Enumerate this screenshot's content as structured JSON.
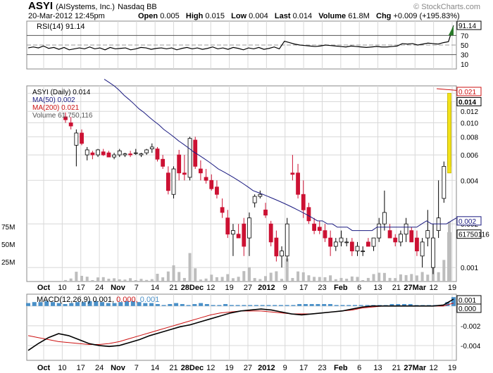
{
  "header": {
    "symbol": "ASYI",
    "company": "(AISystems, Inc.)",
    "exchange": "Nasdaq BB",
    "date": "20-Mar-2012 12:45pm",
    "watermark": "© StockCharts.com",
    "quote": {
      "open_label": "Open",
      "open": "0.005",
      "high_label": "High",
      "high": "0.015",
      "low_label": "Low",
      "low": "0.004",
      "last_label": "Last",
      "last": "0.014",
      "volume_label": "Volume",
      "volume": "61.8M",
      "chg_label": "Chg",
      "chg": "+0.009 (+195.83%)"
    }
  },
  "colors": {
    "up": "#ffffff",
    "down": "#cc1133",
    "ma50": "#1a1a80",
    "ma200": "#cc1111",
    "macd": "#000000",
    "signal": "#cc1111",
    "hist": "#4a90c8",
    "volume": "#bdbdbd",
    "grid": "#d8d8d8",
    "rsi_fill": "#2a7a2a"
  },
  "xaxis": {
    "labels": [
      "Oct",
      "10",
      "17",
      "24",
      "Nov",
      "7",
      "14",
      "21",
      "28Dec",
      "12",
      "19",
      "27",
      "2012",
      "9",
      "17",
      "23",
      "Feb",
      "6",
      "13",
      "21",
      "27Mar",
      "12",
      "19"
    ],
    "bold": [
      "Oct",
      "Nov",
      "28Dec",
      "2012",
      "Feb",
      "27Mar"
    ]
  },
  "chart_data": [
    {
      "type": "line",
      "title": "RSI(14) 91.14",
      "indicator": "RSI(14)",
      "last": 91.14,
      "last_label": "91.14",
      "ylim": [
        0,
        100
      ],
      "yticks": [
        "90",
        "70",
        "50",
        "30",
        "10"
      ],
      "ref_lines": [
        70,
        50,
        30
      ],
      "series": [
        {
          "name": "RSI(14)",
          "values": [
            44,
            46,
            44,
            48,
            43,
            45,
            41,
            45,
            40,
            42,
            44,
            42,
            46,
            42,
            44,
            40,
            45,
            42,
            43,
            44,
            40,
            42,
            45,
            44,
            41,
            43,
            44,
            42,
            44,
            40,
            43,
            45,
            42,
            44,
            41,
            43,
            46,
            42,
            44,
            41,
            45,
            43,
            40,
            44,
            42,
            45,
            41,
            43,
            46,
            42,
            58,
            55,
            52,
            50,
            49,
            48,
            47,
            48,
            50,
            49,
            48,
            47,
            46,
            48,
            47,
            46,
            45,
            46,
            47,
            46,
            46,
            47,
            48,
            53,
            52,
            53,
            50,
            52,
            54,
            53,
            52,
            55,
            57,
            91
          ]
        }
      ]
    },
    {
      "type": "candlestick",
      "title": "ASYI (Daily) 0.014",
      "legend": [
        "ASYI (Daily) 0.014",
        "MA(50) 0.002",
        "MA(200) 0.021",
        "Volume 61,750,116"
      ],
      "scale": "log",
      "ylim": [
        0.0008,
        0.018
      ],
      "yticks": [
        "0.016",
        "0.014",
        "0.012",
        "0.010",
        "0.008",
        "0.006",
        "0.004",
        "0.002",
        "0.001"
      ],
      "price_labels": {
        "last": "0.014",
        "ma50": "0.002",
        "ma200": "0.021",
        "volume": "61750116"
      },
      "volume_ticks": [
        "75M",
        "50M",
        "25M"
      ],
      "candles": [
        [
          0.011,
          0.0118,
          0.01,
          0.0105
        ],
        [
          0.01,
          0.011,
          0.009,
          0.0095
        ],
        [
          0.007,
          0.009,
          0.005,
          0.0085
        ],
        [
          0.0085,
          0.009,
          0.007,
          0.0072
        ],
        [
          0.006,
          0.0068,
          0.0055,
          0.0065
        ],
        [
          0.0062,
          0.0064,
          0.0056,
          0.006
        ],
        [
          0.006,
          0.0066,
          0.0058,
          0.0065
        ],
        [
          0.0063,
          0.0066,
          0.0059,
          0.006
        ],
        [
          0.0062,
          0.0064,
          0.0058,
          0.0058
        ],
        [
          0.0058,
          0.0062,
          0.0056,
          0.006
        ],
        [
          0.006,
          0.0066,
          0.0058,
          0.0064
        ],
        [
          0.006,
          0.0062,
          0.0058,
          0.0061
        ],
        [
          0.0061,
          0.0064,
          0.0058,
          0.006
        ],
        [
          0.0062,
          0.0066,
          0.006,
          0.0062
        ],
        [
          0.006,
          0.0062,
          0.0058,
          0.0061
        ],
        [
          0.0062,
          0.0066,
          0.006,
          0.0065
        ],
        [
          0.0066,
          0.0072,
          0.0062,
          0.0068
        ],
        [
          0.0066,
          0.0068,
          0.0054,
          0.0056
        ],
        [
          0.0056,
          0.006,
          0.0048,
          0.005
        ],
        [
          0.0045,
          0.005,
          0.0032,
          0.0034
        ],
        [
          0.0032,
          0.005,
          0.003,
          0.0048
        ],
        [
          0.006,
          0.0065,
          0.004,
          0.0045
        ],
        [
          0.0045,
          0.006,
          0.004,
          0.0044
        ],
        [
          0.0042,
          0.008,
          0.004,
          0.0078
        ],
        [
          0.0076,
          0.008,
          0.0048,
          0.005
        ],
        [
          0.0048,
          0.0055,
          0.004,
          0.0045
        ],
        [
          0.0042,
          0.0048,
          0.0038,
          0.004
        ],
        [
          0.004,
          0.0044,
          0.0034,
          0.0035
        ],
        [
          0.0036,
          0.004,
          0.003,
          0.0032
        ],
        [
          0.0026,
          0.003,
          0.0022,
          0.0024
        ],
        [
          0.0022,
          0.0025,
          0.0016,
          0.0017
        ],
        [
          0.0017,
          0.002,
          0.0012,
          0.0018
        ],
        [
          0.0017,
          0.002,
          0.0016,
          0.0016
        ],
        [
          0.002,
          0.0022,
          0.0012,
          0.0014
        ],
        [
          0.0016,
          0.0024,
          0.0012,
          0.0022
        ],
        [
          0.0028,
          0.0032,
          0.0026,
          0.0031
        ],
        [
          0.0031,
          0.0034,
          0.003,
          0.0032
        ],
        [
          0.0025,
          0.0028,
          0.0022,
          0.0023
        ],
        [
          0.002,
          0.0021,
          0.0014,
          0.0015
        ],
        [
          0.0016,
          0.0018,
          0.0011,
          0.0012
        ],
        [
          0.0012,
          0.0014,
          0.001,
          0.0013
        ],
        [
          0.0012,
          0.0022,
          0.0011,
          0.002
        ],
        [
          0.0045,
          0.006,
          0.004,
          0.0044
        ],
        [
          0.0045,
          0.0052,
          0.003,
          0.0032
        ],
        [
          0.0032,
          0.004,
          0.0022,
          0.0025
        ],
        [
          0.0026,
          0.0028,
          0.002,
          0.0021
        ],
        [
          0.002,
          0.0022,
          0.0017,
          0.0018
        ],
        [
          0.0019,
          0.0021,
          0.0017,
          0.0018
        ],
        [
          0.0018,
          0.002,
          0.0015,
          0.0016
        ],
        [
          0.0016,
          0.0018,
          0.0012,
          0.0014
        ],
        [
          0.0014,
          0.0016,
          0.0013,
          0.0015
        ],
        [
          0.0015,
          0.0018,
          0.0014,
          0.0016
        ],
        [
          0.0015,
          0.0016,
          0.0014,
          0.0015
        ],
        [
          0.0015,
          0.0016,
          0.0012,
          0.0013
        ],
        [
          0.0013,
          0.0015,
          0.0012,
          0.0014
        ],
        [
          0.0013,
          0.0014,
          0.0012,
          0.0013
        ],
        [
          0.0015,
          0.0016,
          0.0014,
          0.0014
        ],
        [
          0.0014,
          0.0016,
          0.0013,
          0.0016
        ],
        [
          0.0016,
          0.0022,
          0.0015,
          0.002
        ],
        [
          0.002,
          0.0034,
          0.0018,
          0.0024
        ],
        [
          0.0018,
          0.002,
          0.0016,
          0.0016
        ],
        [
          0.0016,
          0.0017,
          0.0014,
          0.0015
        ],
        [
          0.0015,
          0.0018,
          0.0014,
          0.0017
        ],
        [
          0.0017,
          0.0022,
          0.0015,
          0.002
        ],
        [
          0.0018,
          0.0019,
          0.0015,
          0.0015
        ],
        [
          0.0016,
          0.0018,
          0.0012,
          0.0013
        ],
        [
          0.0012,
          0.0016,
          0.001,
          0.0015
        ],
        [
          0.0016,
          0.0025,
          0.0014,
          0.0018
        ],
        [
          0.001,
          0.002,
          0.0009,
          0.0016
        ],
        [
          0.0018,
          0.004,
          0.0016,
          0.0022
        ],
        [
          0.003,
          0.0054,
          0.0028,
          0.005
        ],
        [
          0.005,
          0.016,
          0.0045,
          0.014
        ]
      ],
      "ma50": [
        0.02,
        0.019,
        0.018,
        0.0168,
        0.0155,
        0.0145,
        0.0135,
        0.0125,
        0.0118,
        0.011,
        0.0103,
        0.0097,
        0.009,
        0.0085,
        0.008,
        0.0075,
        0.0071,
        0.0067,
        0.0063,
        0.006,
        0.0057,
        0.0054,
        0.0051,
        0.0048,
        0.0046,
        0.0044,
        0.0042,
        0.004,
        0.0038,
        0.0036,
        0.0034,
        0.0033,
        0.0032,
        0.0031,
        0.003,
        0.0029,
        0.0028,
        0.0027,
        0.0026,
        0.0025,
        0.0024,
        0.0023,
        0.0022,
        0.0021,
        0.0021,
        0.002,
        0.002,
        0.0019,
        0.0019,
        0.0019,
        0.0018,
        0.0018,
        0.0018,
        0.0018,
        0.0018,
        0.0019,
        0.0019,
        0.0019,
        0.0019,
        0.0019,
        0.0019,
        0.0019,
        0.0019,
        0.0019,
        0.002,
        0.0021,
        0.002,
        0.002,
        0.002,
        0.002,
        0.0021,
        0.0022
      ],
      "ma200": [
        0.0215,
        0.0213,
        0.021
      ]
    },
    {
      "type": "line",
      "title": "MACD(12,26,9) 0.001, 0.000, 0.001",
      "legend": {
        "label": "MACD(12,26,9)",
        "macd": "0.001",
        "signal": "0.000",
        "hist": "0.001"
      },
      "ylim": [
        -0.0055,
        0.0012
      ],
      "yticks": [
        "0.000",
        "-0.002",
        "-0.004"
      ],
      "right_labels": [
        "0.001",
        "0.000"
      ],
      "series": [
        {
          "name": "MACD",
          "values": [
            -0.0045,
            -0.0038,
            -0.0032,
            -0.0028,
            -0.003,
            -0.0034,
            -0.0038,
            -0.004,
            -0.0041,
            -0.004,
            -0.0037,
            -0.0034,
            -0.003,
            -0.0027,
            -0.0024,
            -0.0021,
            -0.0019,
            -0.0016,
            -0.0013,
            -0.001,
            -0.0007,
            -0.0005,
            -0.0004,
            -0.0003,
            -0.0004,
            -0.0006,
            -0.0008,
            -0.0009,
            -0.0008,
            -0.0007,
            -0.0006,
            -0.0005,
            -0.0003,
            -0.0001,
            0.0,
            0.0,
            0.0,
            0.0,
            0.0,
            0.0,
            0.0,
            0.0001,
            0.0007
          ]
        },
        {
          "name": "Signal",
          "values": [
            -0.003,
            -0.0032,
            -0.0034,
            -0.0036,
            -0.0037,
            -0.0038,
            -0.0039,
            -0.0039,
            -0.0038,
            -0.0036,
            -0.0033,
            -0.003,
            -0.0027,
            -0.0024,
            -0.0021,
            -0.0018,
            -0.0015,
            -0.0012,
            -0.0009,
            -0.0007,
            -0.0006,
            -0.0005,
            -0.0005,
            -0.0005,
            -0.0006,
            -0.0007,
            -0.0008,
            -0.0008,
            -0.0008,
            -0.0007,
            -0.0006,
            -0.0005,
            -0.0004,
            -0.0002,
            -0.0001,
            0.0,
            0.0,
            0.0,
            0.0,
            0.0,
            0.0,
            0.0,
            0.0003
          ]
        }
      ],
      "histogram": [
        0.0003,
        0.0004,
        0.0004,
        0.0005,
        0.0004,
        0.0003,
        0.0002,
        0.0003,
        0.0004,
        0.0004,
        0.0005,
        0.0005,
        0.0004,
        0.0003,
        0.0003,
        0.0004,
        0.0005,
        0.0005,
        0.0004,
        0.0003,
        0.0003,
        0.0002,
        0.0001,
        0.0002,
        0.0003,
        0.0002,
        0.0001,
        0.0002,
        0.0003,
        0.0002,
        0.0001,
        0.0001,
        0.0002,
        0.0001,
        0.0001,
        0.0001,
        0.0001,
        0.0001,
        0.0001,
        0.0001,
        0.0001,
        0.0001,
        0.0001,
        0.0001,
        0.0002,
        0.0002,
        0.0002,
        0.0002,
        0.0002,
        0.0002,
        0.0001,
        0.0001,
        0.0001,
        0.0001,
        0.0001,
        0.0001,
        0.0001,
        0.0001,
        0.0001,
        0.0002,
        0.0002,
        0.0002,
        0.0002,
        0.0001,
        0.0001,
        0.0001,
        0.0001,
        0.0001,
        0.0004,
        0.0009
      ]
    }
  ]
}
